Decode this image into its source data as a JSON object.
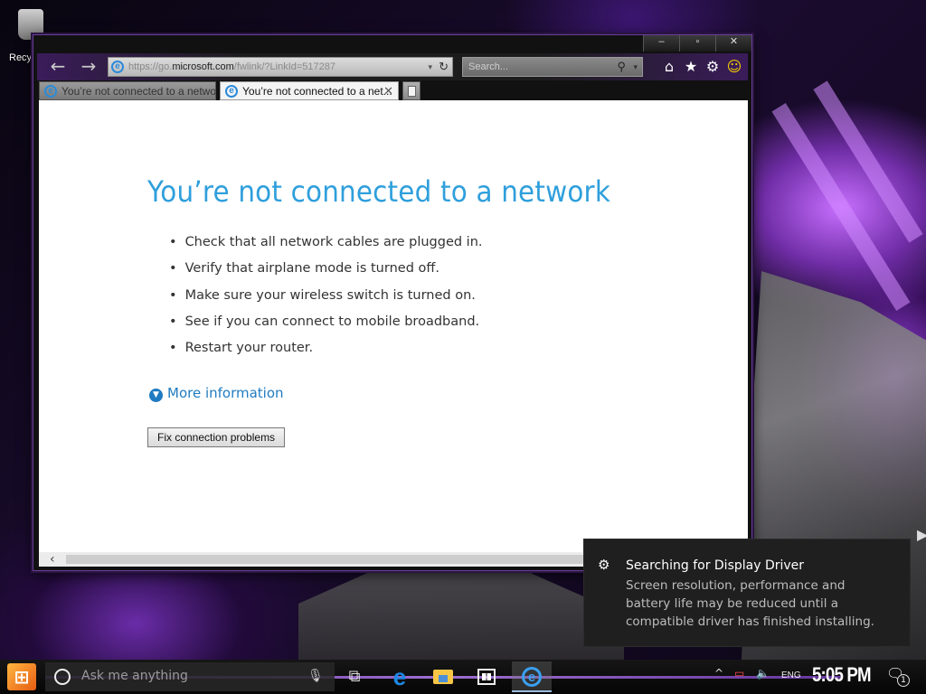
{
  "desktop": {
    "recycle_label": "Recy"
  },
  "browser": {
    "window_controls": {
      "minimize": "–",
      "maximize": "▫",
      "close": "✕"
    },
    "nav": {
      "back": "←",
      "forward": "→"
    },
    "address": {
      "prefix": "https://go.",
      "host": "microsoft.com",
      "suffix": "/fwlink/?LinkId=517287",
      "refresh": "↻",
      "dropdown": "▾"
    },
    "search": {
      "placeholder": "Search...",
      "icon": "⚲",
      "dropdown": "▾"
    },
    "toolbar_icons": {
      "home": "⌂",
      "favorites": "★",
      "settings": "⚙",
      "feedback": "☺"
    },
    "tabs": [
      {
        "label": "You’re not connected to a network",
        "active": false
      },
      {
        "label": "You’re not connected to a net...",
        "active": true,
        "close": "✕"
      }
    ],
    "ie_glyph": "e"
  },
  "page": {
    "heading": "You’re not connected to a network",
    "tips": [
      "Check that all network cables are plugged in.",
      "Verify that airplane mode is turned off.",
      "Make sure your wireless switch is turned on.",
      "See if you can connect to mobile broadband.",
      "Restart your router."
    ],
    "more_info": "More information",
    "more_info_chevron": "▼",
    "fix_button": "Fix connection problems",
    "scroll_left": "‹"
  },
  "toast": {
    "icon": "⚙",
    "title": "Searching for Display Driver",
    "body": "Screen resolution, performance and battery life may be reduced until a compatible driver has finished installing."
  },
  "taskbar": {
    "start_glyph": "⊞",
    "search_placeholder": "Ask me anything",
    "mic": "🎙",
    "task_view": "⧉",
    "edge_glyph": "e",
    "tray": {
      "chevron": "^",
      "network": "▭",
      "volume": "🔈",
      "language": "ENG"
    },
    "clock": "5:05 PM",
    "action_center": "🗨",
    "notification_count": "1"
  },
  "colors": {
    "heading_blue": "#2f9fdc",
    "link_blue": "#1f7bc1",
    "accent_purple": "#7a3fc0",
    "toast_bg": "#1f1f1f"
  }
}
